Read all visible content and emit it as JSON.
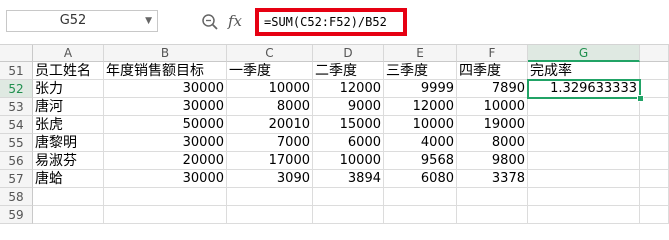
{
  "formula_bar": {
    "cell_reference": "G52",
    "dropdown_icon": "chevron-down-icon",
    "zoom_icon": "magnifier-icon",
    "fx_label": "fx",
    "formula": "=SUM(C52:F52)/B52",
    "highlight_color": "#e60012"
  },
  "sheet": {
    "columns": [
      "A",
      "B",
      "C",
      "D",
      "E",
      "F",
      "G"
    ],
    "selected_column": "G",
    "selected_row": "52",
    "active_cell": "G52",
    "accent_color": "#21a366",
    "rows": [
      {
        "num": "51",
        "cells": [
          "员工姓名",
          "年度销售额目标",
          "一季度",
          "二季度",
          "三季度",
          "四季度",
          "完成率"
        ]
      },
      {
        "num": "52",
        "cells": [
          "张力",
          "30000",
          "10000",
          "12000",
          "9999",
          "7890",
          "1.329633333"
        ]
      },
      {
        "num": "53",
        "cells": [
          "唐河",
          "30000",
          "8000",
          "9000",
          "12000",
          "10000",
          ""
        ]
      },
      {
        "num": "54",
        "cells": [
          "张虎",
          "50000",
          "20010",
          "15000",
          "10000",
          "19000",
          ""
        ]
      },
      {
        "num": "55",
        "cells": [
          "唐黎明",
          "30000",
          "7000",
          "6000",
          "4000",
          "8000",
          ""
        ]
      },
      {
        "num": "56",
        "cells": [
          "易淑芬",
          "20000",
          "17000",
          "10000",
          "9568",
          "9800",
          ""
        ]
      },
      {
        "num": "57",
        "cells": [
          "唐蛤",
          "30000",
          "3090",
          "3894",
          "6080",
          "3378",
          ""
        ]
      },
      {
        "num": "58",
        "cells": [
          "",
          "",
          "",
          "",
          "",
          "",
          ""
        ]
      },
      {
        "num": "59",
        "cells": [
          "",
          "",
          "",
          "",
          "",
          "",
          ""
        ]
      }
    ]
  }
}
